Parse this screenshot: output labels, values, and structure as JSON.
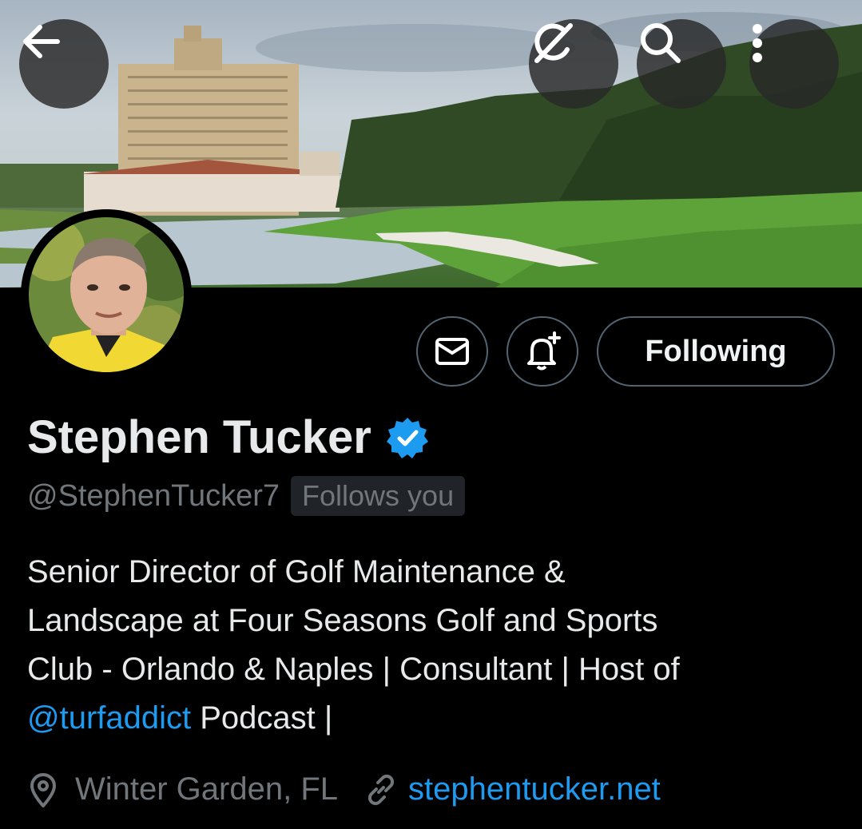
{
  "header": {
    "back_icon": "arrow-left-icon",
    "grok_icon": "grok-icon",
    "search_icon": "search-icon",
    "more_icon": "more-vertical-icon"
  },
  "banner": {
    "description_icon": "golf-course-banner"
  },
  "profile": {
    "name": "Stephen Tucker",
    "verified": true,
    "handle": "@StephenTucker7",
    "follows_you": "Follows you",
    "bio_line1": "Senior Director of Golf Maintenance &",
    "bio_line2": "Landscape at Four Seasons Golf and Sports",
    "bio_line3": "Club - Orlando & Naples | Consultant | Host of",
    "bio_mention": "@turfaddict",
    "bio_tail": " Podcast |",
    "location": "Winter Garden, FL",
    "website": "stephentucker.net"
  },
  "actions": {
    "message_icon": "envelope-icon",
    "notify_icon": "bell-plus-icon",
    "following_label": "Following"
  },
  "colors": {
    "background": "#000000",
    "text_primary": "#e7e9ea",
    "text_secondary": "#71767b",
    "accent": "#1d9bf0",
    "border": "#536471"
  }
}
